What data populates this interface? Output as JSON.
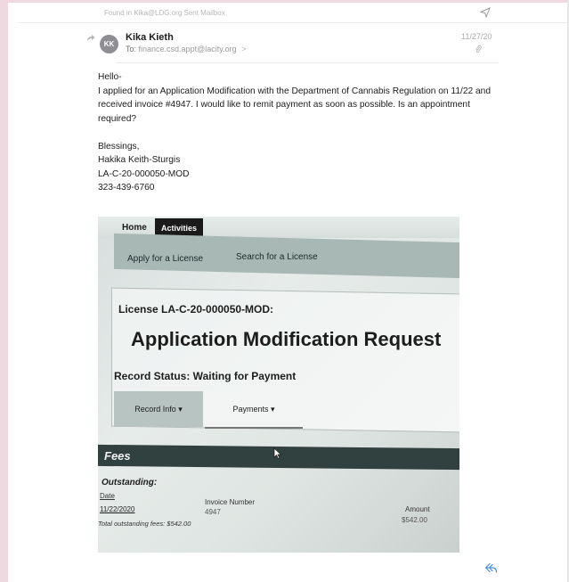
{
  "found_in": "Found in Kika@LDG.org Sent Mailbox",
  "header": {
    "avatar_initials": "KK",
    "sender_name": "Kika Kieth",
    "to_label": "To:",
    "to_address": "finance.csd.appt@lacity.org",
    "to_chevron": ">",
    "date": "11/27/20"
  },
  "body": {
    "greeting": "Hello-",
    "message": "I applied for an Application Modification with the Department of Cannabis Regulation on 11/22 and received invoice #4947. I would like to remit payment as soon as possible. Is an appointment required?",
    "signoff": "Blessings,",
    "name": "Hakika Keith-Sturgis",
    "license": "LA-C-20-000050-MOD",
    "phone": "323-439-6760"
  },
  "attachment": {
    "nav_home": "Home",
    "nav_activities": "Activities",
    "sub_apply": "Apply for a License",
    "sub_search": "Search for a License",
    "license_label": "License LA-C-20-000050-MOD:",
    "title": "Application Modification Request",
    "record_status": "Record Status: Waiting for Payment",
    "btn_record_info": "Record Info ▾",
    "btn_payments": "Payments ▾",
    "fees_heading": "Fees",
    "outstanding": "Outstanding:",
    "col_date": "Date",
    "col_invoice": "Invoice Number",
    "col_amount": "Amount",
    "row_date": "11/22/2020",
    "row_invoice": "4947",
    "row_amount": "$542.00",
    "total": "Total outstanding fees: $542.00"
  },
  "colors": {
    "rail_pink": "#f0d8e0",
    "link_blue": "#4a8fe0",
    "avatar_gray": "#8e8e93"
  },
  "icons": [
    "send-icon",
    "forward-arrow-icon",
    "paperclip-icon",
    "reply-icon",
    "mouse-cursor-icon"
  ]
}
